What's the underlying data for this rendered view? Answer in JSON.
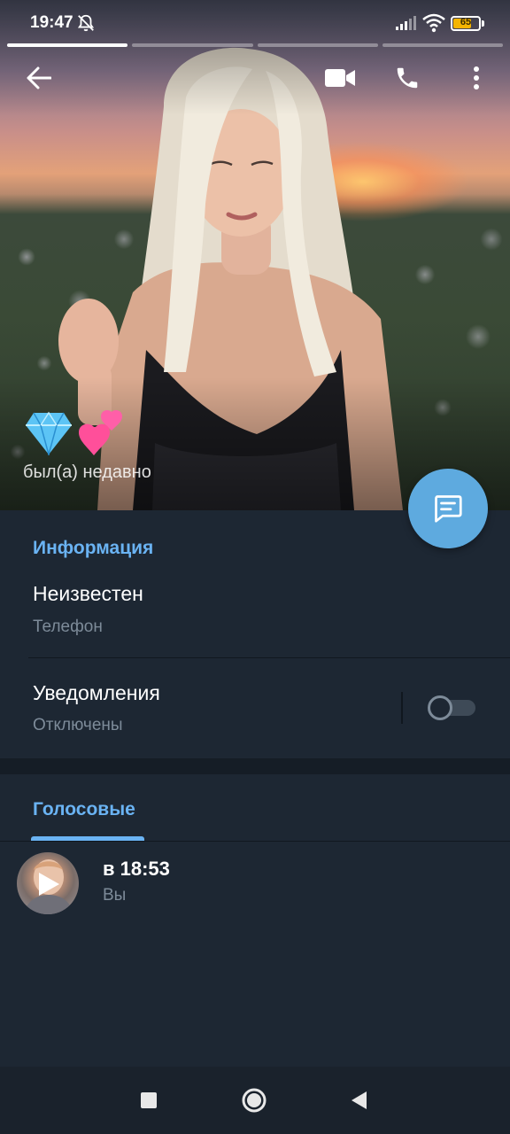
{
  "status_bar": {
    "time": "19:47",
    "battery": "65",
    "icons": [
      "mute-bell-icon",
      "signal-icon",
      "wifi-icon",
      "battery-icon"
    ]
  },
  "story_progress": {
    "segments": 4,
    "active_index": 0
  },
  "toolbar": {
    "icons": [
      "back-arrow-icon",
      "video-call-icon",
      "phone-icon",
      "more-vert-icon"
    ]
  },
  "profile": {
    "emoji": [
      "💎",
      "💕"
    ],
    "status": "был(а) недавно"
  },
  "fab": {
    "icon": "message-icon"
  },
  "info": {
    "header": "Информация",
    "phone_value": "Неизвестен",
    "phone_label": "Телефон",
    "notifications_label": "Уведомления",
    "notifications_state": "Отключены",
    "notifications_enabled": false
  },
  "tabs": {
    "active": "Голосовые"
  },
  "voice_messages": [
    {
      "time": "в 18:53",
      "author": "Вы"
    }
  ],
  "colors": {
    "accent": "#6ab3f3",
    "fab": "#5eaadf",
    "background": "#1d2733",
    "secondary_text": "#7d8b99"
  }
}
